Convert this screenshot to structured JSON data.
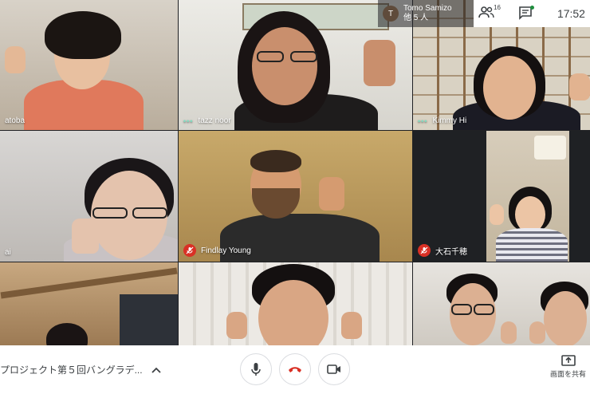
{
  "host": {
    "initial": "T",
    "name": "Tomo Samizo",
    "others": "他 5 人"
  },
  "topbar": {
    "participants_count": "16",
    "clock": "17:52"
  },
  "tiles": [
    {
      "name": "atoba",
      "muted": false,
      "show_dots": false
    },
    {
      "name": "tazz noor",
      "muted": false,
      "show_dots": true
    },
    {
      "name": "Kimmy Hi",
      "muted": false,
      "show_dots": true
    },
    {
      "name": "ai",
      "muted": false,
      "show_dots": false
    },
    {
      "name": "Findlay Young",
      "muted": true,
      "show_dots": false
    },
    {
      "name": "大石千穂",
      "muted": true,
      "show_dots": false
    },
    {
      "name": "",
      "muted": false,
      "show_dots": false
    },
    {
      "name": "",
      "muted": false,
      "show_dots": false
    },
    {
      "name": "",
      "muted": false,
      "show_dots": false
    }
  ],
  "bottom": {
    "meeting_title": "プロジェクト第５回バングラデ...",
    "share_label": "画面を共有"
  },
  "colors": {
    "end_call": "#d93025",
    "mic_off": "#d93025",
    "dots": "#7ee0c3"
  }
}
